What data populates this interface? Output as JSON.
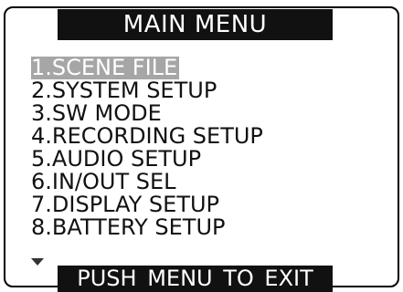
{
  "header": {
    "title": "MAIN MENU"
  },
  "menu": {
    "items": [
      {
        "label": "1.SCENE FILE",
        "selected": true
      },
      {
        "label": "2.SYSTEM SETUP",
        "selected": false
      },
      {
        "label": "3.SW MODE",
        "selected": false
      },
      {
        "label": "4.RECORDING SETUP",
        "selected": false
      },
      {
        "label": "5.AUDIO SETUP",
        "selected": false
      },
      {
        "label": "6.IN/OUT SEL",
        "selected": false
      },
      {
        "label": "7.DISPLAY SETUP",
        "selected": false
      },
      {
        "label": "8.BATTERY SETUP",
        "selected": false
      }
    ],
    "more_indicator_icon": "triangle-down-icon"
  },
  "footer": {
    "hint": "PUSH MENU TO EXIT"
  },
  "colors": {
    "bar_background": "#111111",
    "bar_text": "#ffffff",
    "selection_background": "#a6a6a6",
    "text": "#111111",
    "background": "#ffffff"
  }
}
